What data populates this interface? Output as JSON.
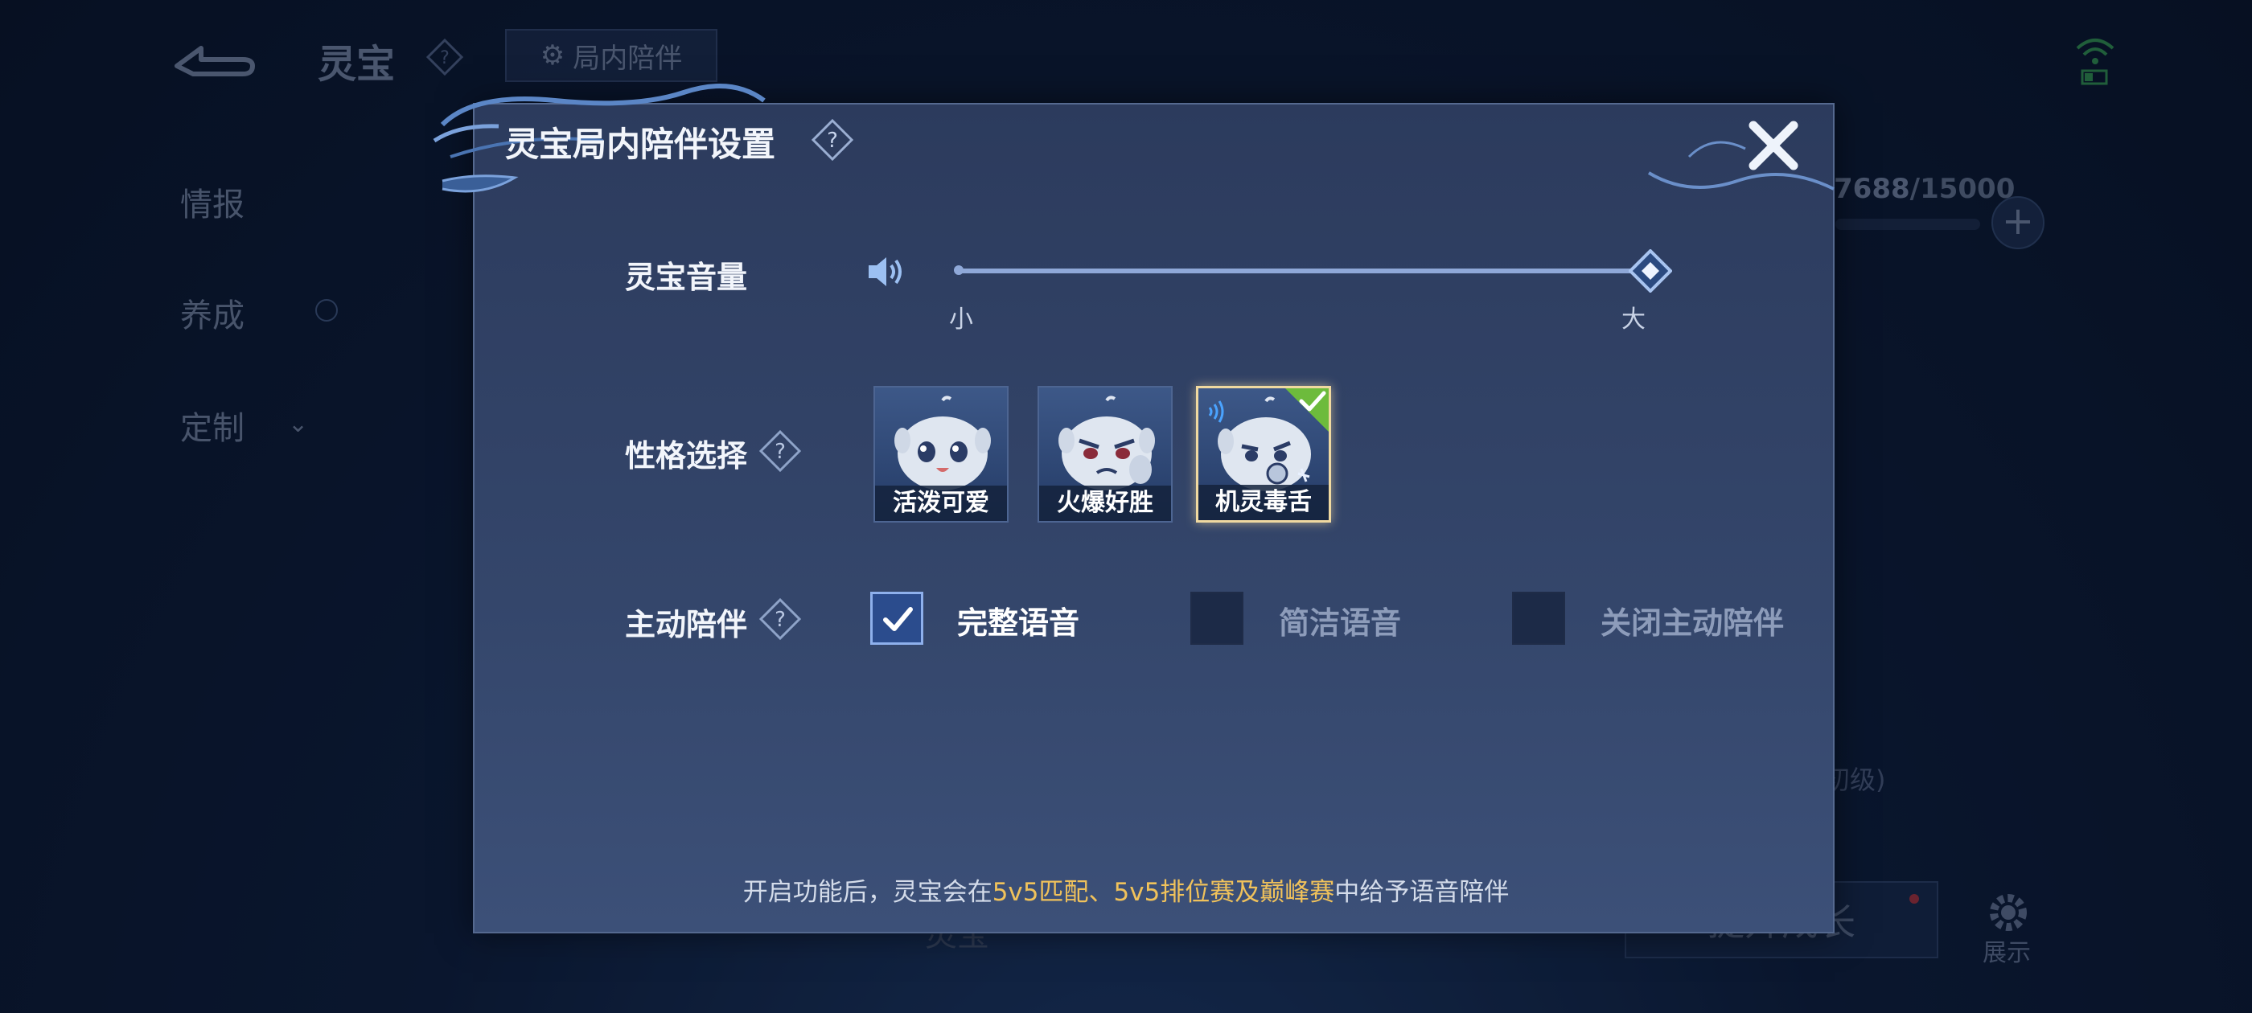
{
  "background": {
    "title": "灵宝",
    "tab_label": "局内陪伴",
    "sidebar": [
      {
        "label": "情报"
      },
      {
        "label": "养成"
      },
      {
        "label": "定制"
      }
    ],
    "count": {
      "current": "7688",
      "separator": "/",
      "max": "15000"
    },
    "level_hint": "初级)",
    "bottom_name": "灵宝",
    "grow_button": "提升成长",
    "show_label": "展示"
  },
  "dialog": {
    "title": "灵宝局内陪伴设置",
    "volume": {
      "label": "灵宝音量",
      "min_label": "小",
      "max_label": "大",
      "value_fraction": 1.0
    },
    "personality": {
      "label": "性格选择",
      "options": [
        {
          "label": "活泼可爱",
          "selected": false
        },
        {
          "label": "火爆好胜",
          "selected": false
        },
        {
          "label": "机灵毒舌",
          "selected": true
        }
      ]
    },
    "companion": {
      "label": "主动陪伴",
      "options": [
        {
          "label": "完整语音",
          "checked": true
        },
        {
          "label": "简洁语音",
          "checked": false
        },
        {
          "label": "关闭主动陪伴",
          "checked": false
        }
      ]
    },
    "footer": {
      "prefix": "开启功能后，灵宝会在",
      "highlight": "5v5匹配、5v5排位赛及巅峰赛",
      "suffix": "中给予语音陪伴"
    }
  },
  "colors": {
    "accent_highlight": "#f0c25b",
    "selected_border": "#f0d9a0",
    "check_green": "#6dbb3c"
  }
}
